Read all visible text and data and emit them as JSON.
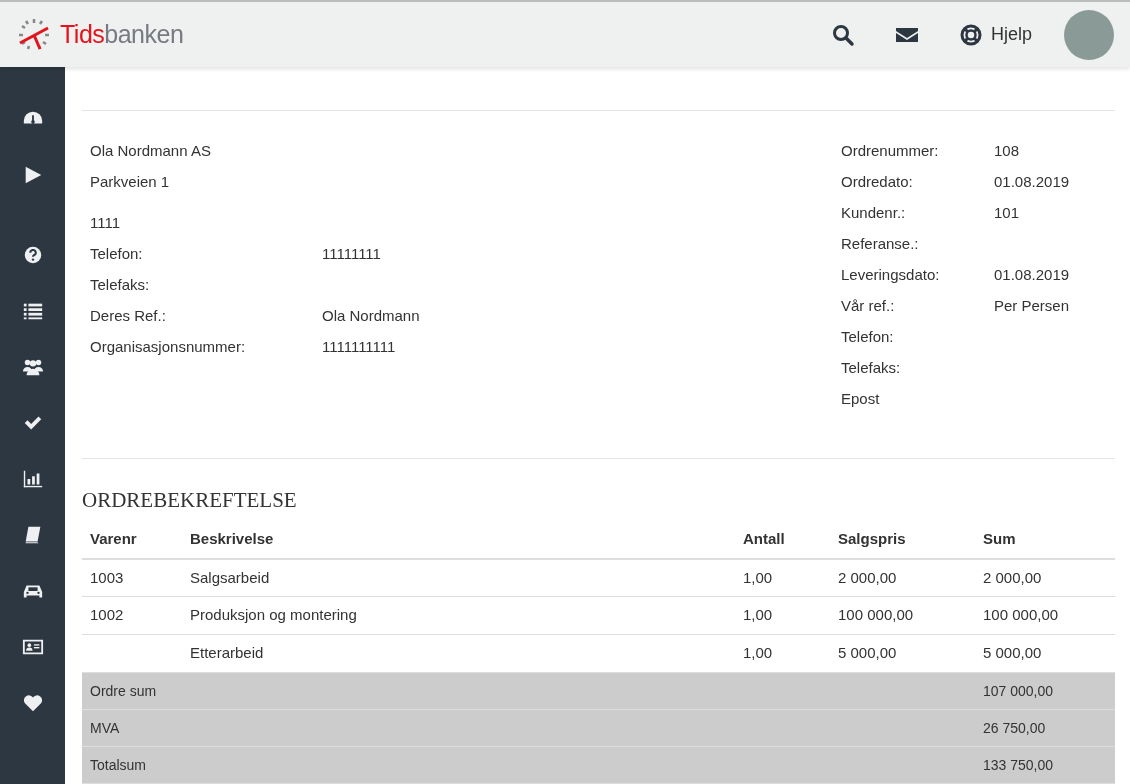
{
  "header": {
    "logo_text": [
      "Tids",
      "banken"
    ],
    "actions": [
      {
        "kind": "search"
      },
      {
        "kind": "mail"
      },
      {
        "kind": "help",
        "label": "Hjelp"
      }
    ]
  },
  "sidebar": {
    "items": [
      {
        "kind": "gauge"
      },
      {
        "kind": "play"
      },
      {
        "kind": "question"
      },
      {
        "kind": "list"
      },
      {
        "kind": "users"
      },
      {
        "kind": "check"
      },
      {
        "kind": "chart"
      },
      {
        "kind": "book"
      },
      {
        "kind": "car"
      },
      {
        "kind": "idcard"
      },
      {
        "kind": "heart"
      }
    ]
  },
  "customer": {
    "address_lines": [
      "Ola Nordmann AS",
      "Parkveien 1",
      "1111"
    ],
    "fields": [
      {
        "label": "Telefon:",
        "value": "11111111"
      },
      {
        "label": "Telefaks:"
      },
      {
        "label": "Deres Ref.:",
        "value": "Ola Nordmann"
      },
      {
        "label": "Organisasjonsnummer:",
        "value": "1111111111"
      }
    ]
  },
  "order_info": [
    {
      "label": "Ordrenummer:",
      "value": "108"
    },
    {
      "label": "Ordredato:",
      "value": "01.08.2019"
    },
    {
      "label": "Kundenr.:",
      "value": "101"
    },
    {
      "label": "Referanse.:"
    },
    {
      "label": "Leveringsdato:",
      "value": "01.08.2019"
    },
    {
      "label": "Vår ref.:",
      "value": "Per Persen"
    },
    {
      "label": "Telefon:"
    },
    {
      "label": "Telefaks:"
    },
    {
      "label": "Epost"
    }
  ],
  "title": "ORDREBEKREFTELSE",
  "table": {
    "columns": [
      "Varenr",
      "Beskrivelse",
      "Antall",
      "Salgspris",
      "Sum"
    ],
    "rows": [
      [
        "1003",
        "Salgsarbeid",
        "1,00",
        "2 000,00",
        "2 000,00"
      ],
      [
        "1002",
        "Produksjon og montering",
        "1,00",
        "100 000,00",
        "100 000,00"
      ],
      [
        "",
        "Etterarbeid",
        "1,00",
        "5 000,00",
        "5 000,00"
      ]
    ],
    "totals": [
      {
        "label": "Ordre sum",
        "value": "107 000,00"
      },
      {
        "label": "MVA",
        "value": "26 750,00"
      },
      {
        "label": "Totalsum",
        "value": "133 750,00"
      }
    ]
  }
}
